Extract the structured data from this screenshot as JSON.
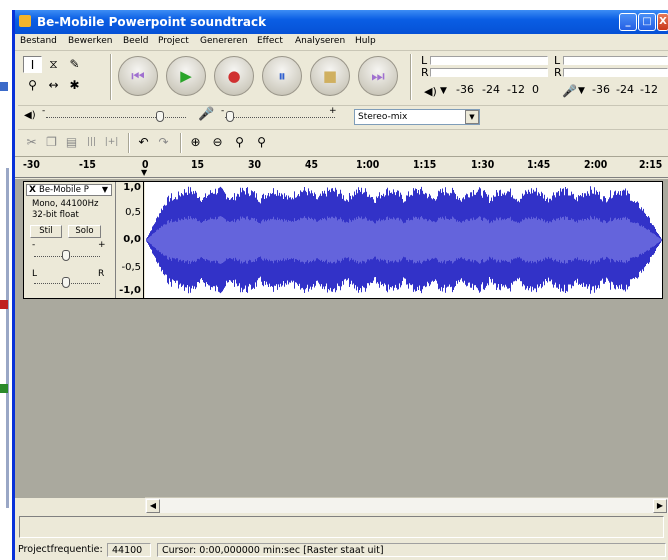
{
  "window": {
    "title": "Be-Mobile Powerpoint soundtrack",
    "controls": [
      "_",
      "□",
      "X"
    ]
  },
  "menubar": {
    "items": [
      "Bestand",
      "Bewerken",
      "Beeld",
      "Project",
      "Genereren",
      "Effect",
      "Analyseren",
      "Hulp"
    ]
  },
  "tools": {
    "row1": [
      "selection-tool",
      "envelope-tool",
      "draw-tool"
    ],
    "row2": [
      "zoom-tool",
      "timeshift-tool",
      "multi-tool"
    ]
  },
  "transport": [
    "skip-start",
    "play",
    "record",
    "pause",
    "stop",
    "skip-end"
  ],
  "meters": {
    "play": {
      "channel_left": "L",
      "channel_right": "R",
      "scale": [
        "-36",
        "-24",
        "-12",
        "0"
      ]
    },
    "record": {
      "channel_left": "L",
      "channel_right": "R",
      "scale": [
        "-36",
        "-24",
        "-12"
      ]
    }
  },
  "mixer": {
    "input_source": "Stereo-mix",
    "output_minus": "-",
    "output_plus": "+"
  },
  "ruler": {
    "labels": [
      "-30",
      "-15",
      "0",
      "15",
      "30",
      "45",
      "1:00",
      "1:15",
      "1:30",
      "1:45",
      "2:00",
      "2:15"
    ]
  },
  "track": {
    "name": "Be-Mobile P",
    "close": "X",
    "info_line1": "Mono, 44100Hz",
    "info_line2": "32-bit float",
    "mute_label": "Stil",
    "solo_label": "Solo",
    "gain_minus": "-",
    "gain_plus": "+",
    "pan_left": "L",
    "pan_right": "R",
    "scale": [
      "1,0",
      "0,5",
      "0,0",
      "-0,5",
      "-1,0"
    ]
  },
  "status": {
    "project_rate_label": "Projectfrequentie:",
    "project_rate_value": "44100",
    "cursor_text": "Cursor: 0:00,000000 min:sec  [Raster staat uit]"
  },
  "colors": {
    "titlebar": "#0a5ee4",
    "waveform": "#3232c8",
    "waveform_rms": "#6464dc",
    "track_bg": "#aaa99e"
  }
}
